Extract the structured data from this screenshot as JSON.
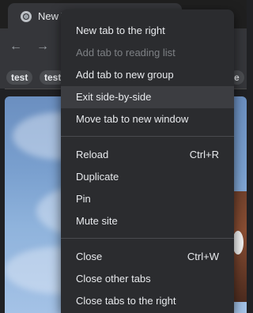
{
  "browser": {
    "tab_title": "New T",
    "bookmarks": [
      "test",
      "test",
      "e"
    ],
    "nav_icons": [
      "back-arrow-icon",
      "forward-arrow-icon"
    ]
  },
  "context_menu": {
    "items": [
      {
        "label": "New tab to the right",
        "state": "normal"
      },
      {
        "label": "Add tab to reading list",
        "state": "disabled"
      },
      {
        "label": "Add tab to new group",
        "state": "normal"
      },
      {
        "label": "Exit side-by-side",
        "state": "highlighted"
      },
      {
        "label": "Move tab to new window",
        "state": "normal"
      },
      {
        "label": "Reload",
        "shortcut": "Ctrl+R",
        "state": "normal"
      },
      {
        "label": "Duplicate",
        "state": "normal"
      },
      {
        "label": "Pin",
        "state": "normal"
      },
      {
        "label": "Mute site",
        "state": "normal"
      },
      {
        "label": "Close",
        "shortcut": "Ctrl+W",
        "state": "normal"
      },
      {
        "label": "Close other tabs",
        "state": "normal"
      },
      {
        "label": "Close tabs to the right",
        "state": "normal"
      }
    ]
  }
}
